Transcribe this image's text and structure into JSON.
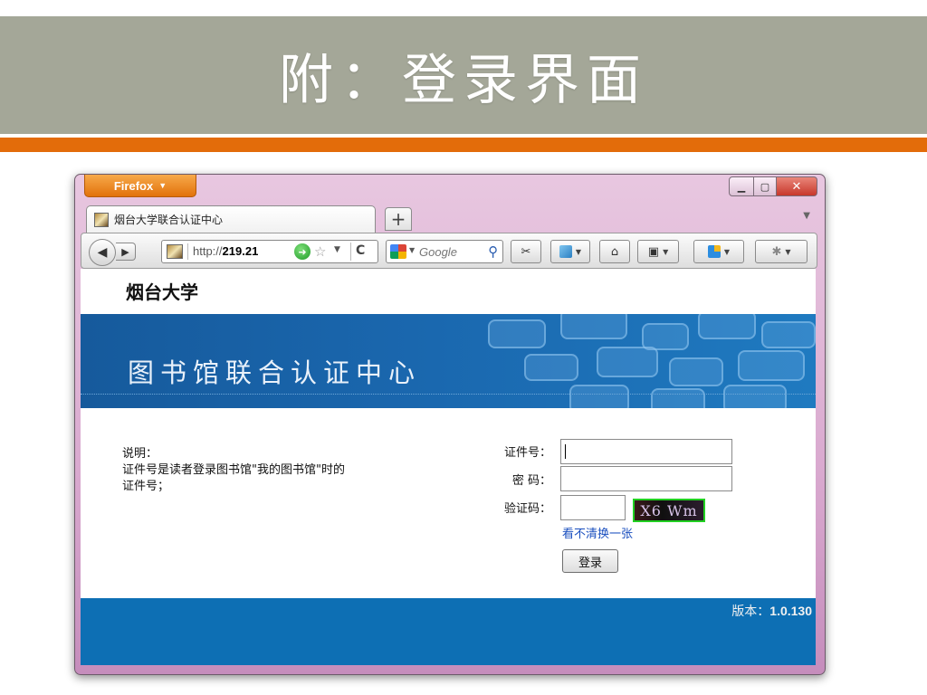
{
  "slide": {
    "title": "附：登录界面",
    "colors": {
      "header_bg": "#a4a798",
      "accent": "#e36c0a"
    }
  },
  "browser": {
    "menu_label": "Firefox",
    "window_controls": {
      "minimize": "minimize-icon",
      "maximize": "maximize-icon",
      "close": "close-icon"
    },
    "tab": {
      "title": "烟台大学联合认证中心"
    },
    "new_tab_label": "+",
    "url": {
      "prefix": "http://",
      "host": "219.21"
    },
    "search": {
      "placeholder": "Google"
    }
  },
  "page": {
    "university": "烟台大学",
    "banner_title": "图书馆联合认证中心",
    "description": {
      "heading": "说明：",
      "line1": "证件号是读者登录图书馆\"我的图书馆\"时的",
      "line2": "证件号；"
    },
    "form": {
      "id_label": "证件号：",
      "id_value": "",
      "password_label": "密 码：",
      "password_value": "",
      "captcha_label": "验证码：",
      "captcha_value": "",
      "captcha_image_text": "X6 Wm",
      "refresh_link": "看不清换一张",
      "login_button": "登录"
    },
    "footer": {
      "version_label": "版本：",
      "version_number": "1.0.130"
    },
    "colors": {
      "banner": "#1a67ae",
      "footer": "#0d6fb4",
      "link": "#1a4fbf"
    }
  }
}
